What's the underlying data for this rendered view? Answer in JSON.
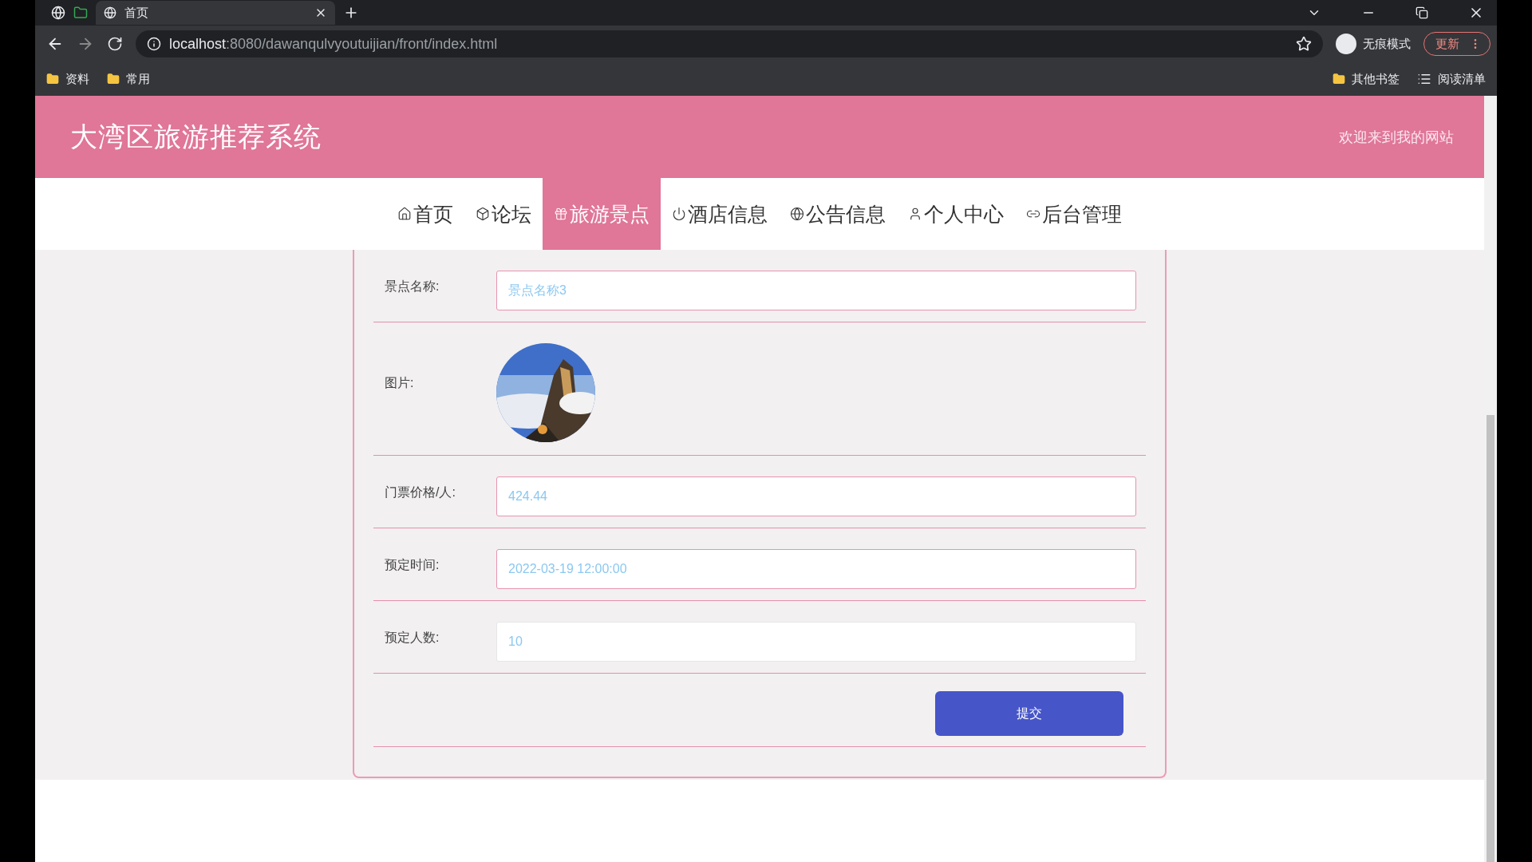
{
  "browser": {
    "tabs": [
      {
        "title": "首页",
        "selected": true
      }
    ],
    "address": {
      "host": "localhost",
      "path": ":8080/dawanqulvyoutuijian/front/index.html"
    },
    "profile": "无痕模式",
    "update_button": "更新",
    "bookmarks": [
      "资料",
      "常用"
    ],
    "bookmarks_right": [
      "其他书签",
      "阅读清单"
    ]
  },
  "header": {
    "title": "大湾区旅游推荐系统",
    "welcome": "欢迎来到我的网站"
  },
  "nav": [
    {
      "label": "首页",
      "selected": false
    },
    {
      "label": "论坛",
      "selected": false
    },
    {
      "label": "旅游景点",
      "selected": true
    },
    {
      "label": "酒店信息",
      "selected": false
    },
    {
      "label": "公告信息",
      "selected": false
    },
    {
      "label": "个人中心",
      "selected": false
    },
    {
      "label": "后台管理",
      "selected": false
    }
  ],
  "form": {
    "rows": [
      {
        "kind": "text",
        "label": "景点名称:",
        "value": "景点名称3"
      },
      {
        "label": "图片:"
      },
      {
        "kind": "text",
        "label": "门票价格/人:",
        "value": "424.44"
      },
      {
        "kind": "text",
        "label": "预定时间:",
        "value": "2022-03-19 12:00:00"
      },
      {
        "kind": "text",
        "label": "预定人数:",
        "value": "10"
      }
    ],
    "submit": "提交"
  }
}
